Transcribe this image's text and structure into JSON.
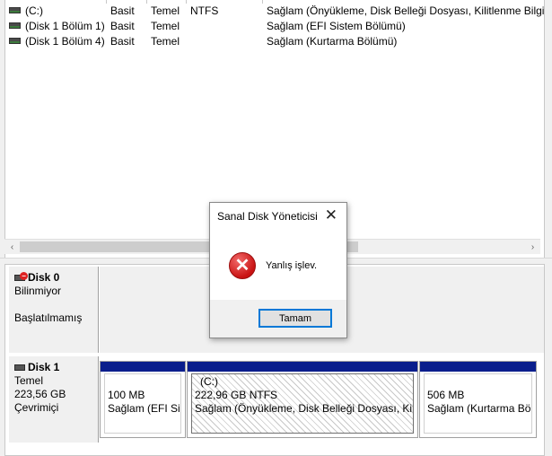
{
  "volumes": [
    {
      "name": "(C:)",
      "layout": "Basit",
      "type": "Temel",
      "fs": "NTFS",
      "status": "Sağlam (Önyükleme, Disk Belleği Dosyası, Kilitlenme Bilgis"
    },
    {
      "name": "(Disk 1 Bölüm 1)",
      "layout": "Basit",
      "type": "Temel",
      "fs": "",
      "status": "Sağlam (EFI Sistem Bölümü)"
    },
    {
      "name": "(Disk 1 Bölüm 4)",
      "layout": "Basit",
      "type": "Temel",
      "fs": "",
      "status": "Sağlam (Kurtarma Bölümü)"
    }
  ],
  "scroll": {
    "left_arrow": "‹",
    "right_arrow": "›"
  },
  "disks": [
    {
      "name": "Disk 0",
      "type": "Bilinmiyor",
      "size": "",
      "state": "Başlatılmamış"
    },
    {
      "name": "Disk 1",
      "type": "Temel",
      "size": "223,56 GB",
      "state": "Çevrimiçi"
    }
  ],
  "partitions": [
    {
      "label": "",
      "size": "100 MB",
      "status": "Sağlam (EFI Sist"
    },
    {
      "label": "(C:)",
      "size": "222,96 GB NTFS",
      "status": "Sağlam (Önyükleme, Disk Belleği Dosyası, Kilit"
    },
    {
      "label": "",
      "size": "506 MB",
      "status": "Sağlam (Kurtarma Böl"
    }
  ],
  "dialog": {
    "title": "Sanal Disk Yöneticisi",
    "close_glyph": "✕",
    "error_glyph": "✕",
    "message": "Yanlış işlev.",
    "ok_label": "Tamam"
  },
  "colors": {
    "partition_header": "#0a1e8c",
    "accent": "#0078d7",
    "error": "#c91313"
  }
}
